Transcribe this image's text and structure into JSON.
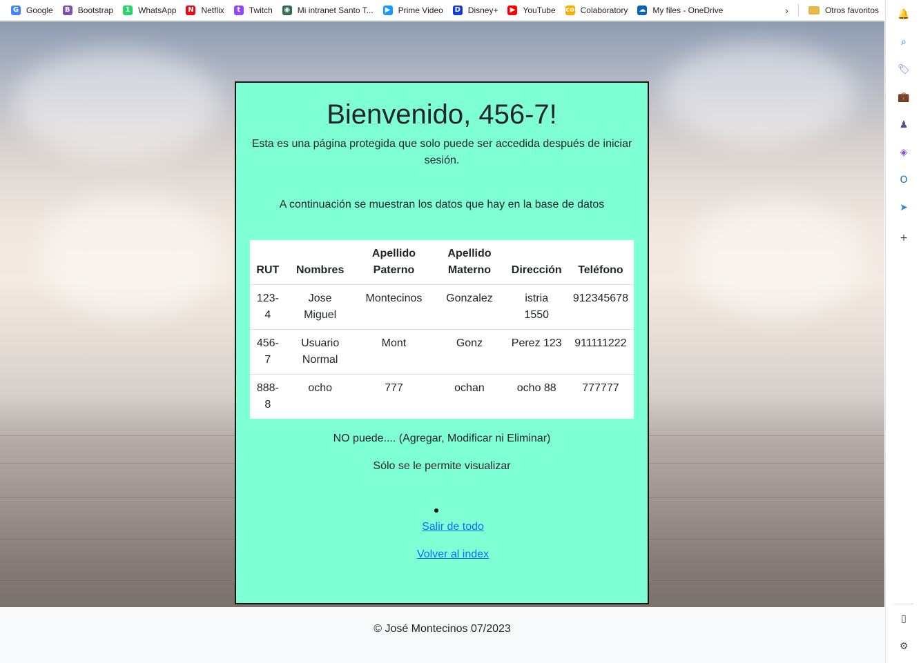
{
  "bookmarks": [
    {
      "label": "Google",
      "icon": "google-icon",
      "color": "#4285f4",
      "glyph": "G"
    },
    {
      "label": "Bootstrap",
      "icon": "bootstrap-icon",
      "color": "#7952b3",
      "glyph": "B"
    },
    {
      "label": "WhatsApp",
      "icon": "whatsapp-icon",
      "color": "#25d366",
      "glyph": "1"
    },
    {
      "label": "Netflix",
      "icon": "netflix-icon",
      "color": "#e50914",
      "glyph": "N"
    },
    {
      "label": "Twitch",
      "icon": "twitch-icon",
      "color": "#9146ff",
      "glyph": "t"
    },
    {
      "label": "Mi intranet Santo T...",
      "icon": "intranet-icon",
      "color": "#2e6b4f",
      "glyph": "◉"
    },
    {
      "label": "Prime Video",
      "icon": "prime-video-icon",
      "color": "#1a98ff",
      "glyph": "▶"
    },
    {
      "label": "Disney+",
      "icon": "disney-icon",
      "color": "#113ccf",
      "glyph": "D"
    },
    {
      "label": "YouTube",
      "icon": "youtube-icon",
      "color": "#ff0000",
      "glyph": "▶"
    },
    {
      "label": "Colaboratory",
      "icon": "colab-icon",
      "color": "#f9ab00",
      "glyph": "co"
    },
    {
      "label": "My files - OneDrive",
      "icon": "onedrive-icon",
      "color": "#0364b8",
      "glyph": "☁"
    }
  ],
  "bookmarks_more_glyph": "›",
  "other_favorites": "Otros favoritos",
  "sidebar_icons": [
    {
      "name": "bell-icon",
      "glyph": "🔔",
      "color": "#1a73e8"
    },
    {
      "name": "search-icon",
      "glyph": "⌕",
      "color": "#1a73e8"
    },
    {
      "name": "tag-icon",
      "glyph": "🏷",
      "color": "#4a7bd9"
    },
    {
      "name": "briefcase-icon",
      "glyph": "💼",
      "color": "#c0392b"
    },
    {
      "name": "chess-icon",
      "glyph": "♟",
      "color": "#5a4a8a"
    },
    {
      "name": "copilot-icon",
      "glyph": "◈",
      "color": "#8a4dd6"
    },
    {
      "name": "outlook-icon",
      "glyph": "O",
      "color": "#0f6cbd"
    },
    {
      "name": "send-icon",
      "glyph": "➤",
      "color": "#2b88d8"
    },
    {
      "name": "add-icon",
      "glyph": "+",
      "color": "#444444"
    },
    {
      "name": "split-view-icon",
      "glyph": "▯",
      "color": "#444444"
    },
    {
      "name": "settings-icon",
      "glyph": "⚙",
      "color": "#444444"
    }
  ],
  "card": {
    "title": "Bienvenido, 456-7!",
    "intro": "Esta es una página protegida que solo puede ser accedida después de iniciar sesión.",
    "lead": "A continuación se muestran los datos que hay en la base de datos",
    "background": "#7fffd4",
    "table": {
      "headers": [
        "RUT",
        "Nombres",
        "Apellido Paterno",
        "Apellido Materno",
        "Dirección",
        "Teléfono"
      ],
      "rows": [
        [
          "123-4",
          "Jose Miguel",
          "Montecinos",
          "Gonzalez",
          "istria 1550",
          "912345678"
        ],
        [
          "456-7",
          "Usuario Normal",
          "Mont",
          "Gonz",
          "Perez 123",
          "911111222"
        ],
        [
          "888-8",
          "ocho",
          "777",
          "ochan",
          "ocho 88",
          "777777"
        ]
      ]
    },
    "note1": "NO puede.... (Agregar, Modificar ni Eliminar)",
    "note2": "Sólo se le permite visualizar",
    "logout_link": "Salir de todo",
    "back_link": "Volver al index",
    "link_color": "#0d6efd"
  },
  "footer": "© José Montecinos 07/2023"
}
